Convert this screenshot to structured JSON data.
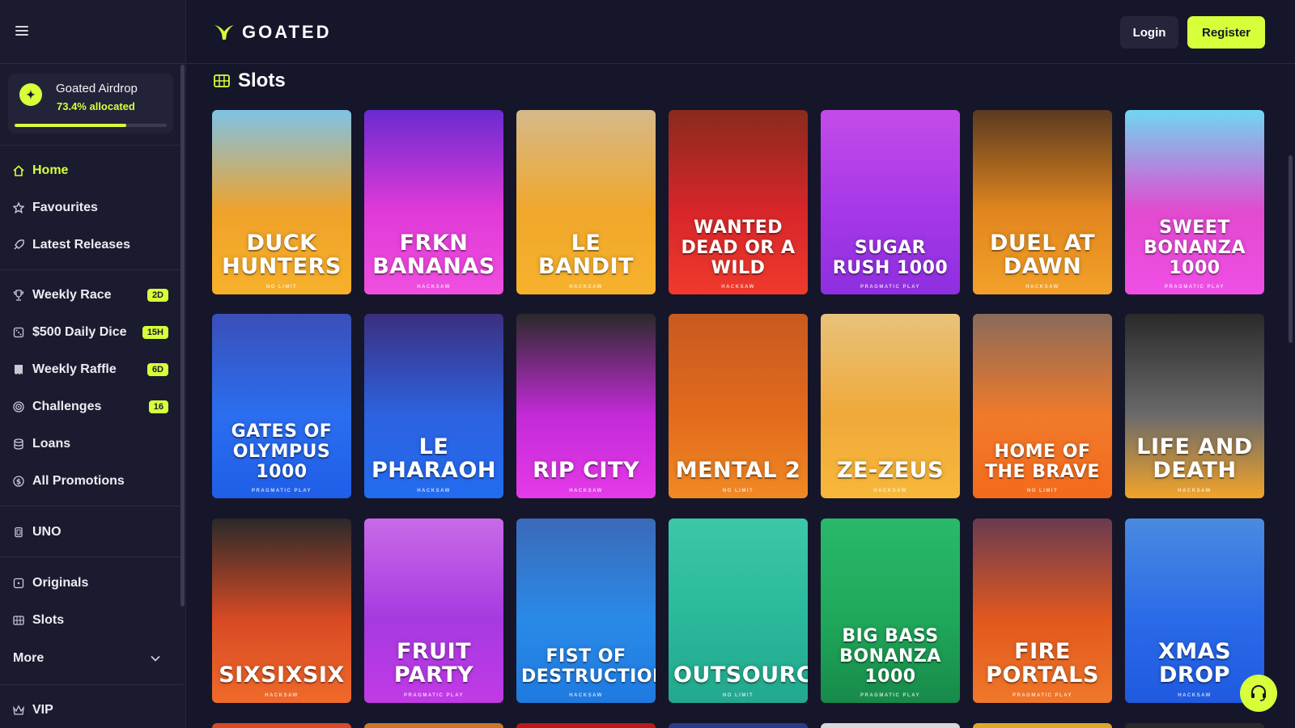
{
  "header": {
    "brand": "GOATED",
    "login_label": "Login",
    "register_label": "Register"
  },
  "sidebar": {
    "airdrop": {
      "title": "Goated Airdrop",
      "allocated_text": "73.4% allocated",
      "allocated_fraction": 0.734
    },
    "items": [
      {
        "label": "Home",
        "icon": "home-icon",
        "active": true
      },
      {
        "label": "Favourites",
        "icon": "star-icon"
      },
      {
        "label": "Latest Releases",
        "icon": "rocket-icon"
      },
      {
        "label": "Weekly Race",
        "icon": "trophy-icon",
        "badge": "2D"
      },
      {
        "label": "$500 Daily Dice",
        "icon": "dice-icon",
        "badge": "15H"
      },
      {
        "label": "Weekly Raffle",
        "icon": "ticket-icon",
        "badge": "6D"
      },
      {
        "label": "Challenges",
        "icon": "target-icon",
        "badge": "16"
      },
      {
        "label": "Loans",
        "icon": "coins-icon"
      },
      {
        "label": "All Promotions",
        "icon": "promo-icon"
      },
      {
        "label": "UNO",
        "icon": "cards-icon"
      },
      {
        "label": "Originals",
        "icon": "originals-icon"
      },
      {
        "label": "Slots",
        "icon": "slots-icon"
      },
      {
        "label": "More",
        "icon": "chevron-down-icon"
      },
      {
        "label": "VIP",
        "icon": "crown-icon"
      }
    ]
  },
  "main": {
    "section_title": "Slots",
    "games": [
      {
        "name": "Duck Hunters",
        "provider": "NO LIMIT",
        "colors": [
          "#7fc3e6",
          "#f0a22a",
          "#f7b12a"
        ]
      },
      {
        "name": "FRKN Bananas",
        "provider": "HACKSAW",
        "colors": [
          "#6a2bd0",
          "#e03ad8",
          "#f04fe0"
        ]
      },
      {
        "name": "Le Bandit",
        "provider": "HACKSAW",
        "colors": [
          "#d6b98a",
          "#f0a72b",
          "#f7b22c"
        ]
      },
      {
        "name": "Wanted Dead or a Wild",
        "provider": "HACKSAW",
        "colors": [
          "#8a2a1c",
          "#d8262a",
          "#f03a2c"
        ]
      },
      {
        "name": "Sugar Rush 1000",
        "provider": "PRAGMATIC PLAY",
        "colors": [
          "#c44be8",
          "#a638e8",
          "#8e2fe0"
        ]
      },
      {
        "name": "Duel at Dawn",
        "provider": "HACKSAW",
        "colors": [
          "#5a3a20",
          "#e2861e",
          "#f2a12a"
        ]
      },
      {
        "name": "Sweet Bonanza 1000",
        "provider": "PRAGMATIC PLAY",
        "colors": [
          "#6fd7f0",
          "#e24ad0",
          "#f04ee6"
        ]
      },
      {
        "name": "Gates of Olympus 1000",
        "provider": "PRAGMATIC PLAY",
        "colors": [
          "#3a4fb8",
          "#2b6ef0",
          "#1f5ee8"
        ]
      },
      {
        "name": "Le Pharaoh",
        "provider": "HACKSAW",
        "colors": [
          "#3b2f80",
          "#2d62e0",
          "#226cf0"
        ]
      },
      {
        "name": "Rip City",
        "provider": "HACKSAW",
        "colors": [
          "#2a2a2a",
          "#c42ad8",
          "#e53ae8"
        ]
      },
      {
        "name": "Mental 2",
        "provider": "NO LIMIT",
        "colors": [
          "#c85a20",
          "#e26a1c",
          "#f08a24"
        ]
      },
      {
        "name": "Ze-Zeus",
        "provider": "HACKSAW",
        "colors": [
          "#e8c27a",
          "#f0a93a",
          "#f7b83a"
        ]
      },
      {
        "name": "Home of the Brave",
        "provider": "NO LIMIT",
        "colors": [
          "#8a6a5a",
          "#f07a2a",
          "#f56a1c"
        ]
      },
      {
        "name": "Life and Death",
        "provider": "HACKSAW",
        "colors": [
          "#2a2a2a",
          "#6a6a6a",
          "#f2a42a"
        ]
      },
      {
        "name": "Sixsixsix",
        "provider": "HACKSAW",
        "colors": [
          "#2a2a2a",
          "#d84a24",
          "#f06a2a"
        ]
      },
      {
        "name": "Fruit Party",
        "provider": "PRAGMATIC PLAY",
        "colors": [
          "#c86ae8",
          "#a63ae0",
          "#c23ae6"
        ]
      },
      {
        "name": "Fist of Destruction",
        "provider": "HACKSAW",
        "colors": [
          "#3a6ab8",
          "#2a8ae8",
          "#1f7ae0"
        ]
      },
      {
        "name": "Outsourced",
        "provider": "NO LIMIT",
        "colors": [
          "#3ac8a8",
          "#2ab89a",
          "#22a88e"
        ]
      },
      {
        "name": "Big Bass Bonanza 1000",
        "provider": "PRAGMATIC PLAY",
        "colors": [
          "#2ab86a",
          "#1fa85a",
          "#188a4a"
        ]
      },
      {
        "name": "Fire Portals",
        "provider": "PRAGMATIC PLAY",
        "colors": [
          "#6a3a50",
          "#e2581e",
          "#f0782a"
        ]
      },
      {
        "name": "Xmas Drop",
        "provider": "HACKSAW",
        "colors": [
          "#4a8ae0",
          "#2a6ae8",
          "#1f5ae0"
        ]
      }
    ],
    "bottom_strip_colors": [
      "#d8482a",
      "#c8762a",
      "#b81a1a",
      "#2a3a8a",
      "#d8d8d8",
      "#e0a62a",
      "#2a2a2a"
    ]
  },
  "colors": {
    "accent": "#d7ff3a",
    "background": "#15162a",
    "sidebar": "#1a1b2e"
  }
}
